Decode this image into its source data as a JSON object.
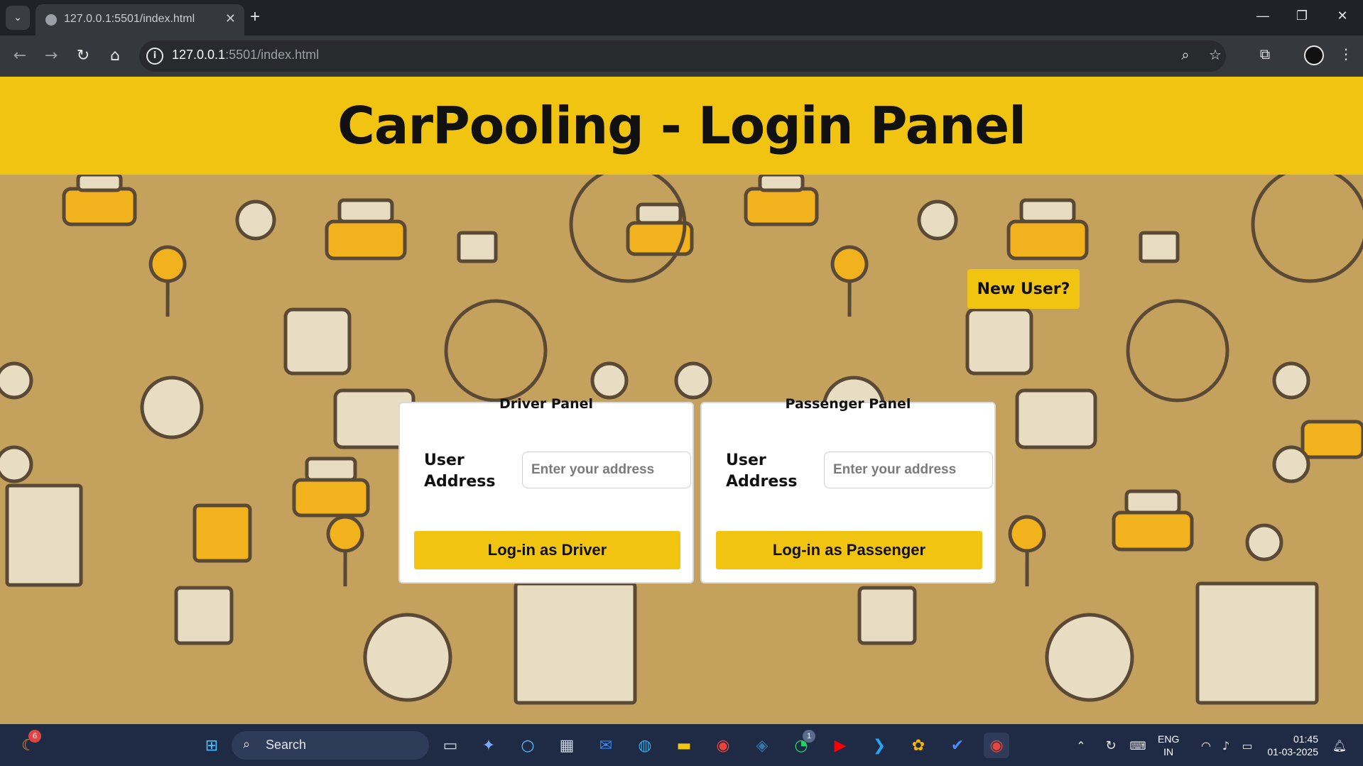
{
  "browser": {
    "tab_title": "127.0.0.1:5501/index.html",
    "url_host": "127.0.0.1",
    "url_rest": ":5501/index.html"
  },
  "page": {
    "heading": "CarPooling - Login Panel",
    "new_user_label": "New User?",
    "panels": [
      {
        "title": "Driver Panel",
        "field_label": "User Address",
        "placeholder": "Enter your address",
        "button": "Log-in as Driver"
      },
      {
        "title": "Passenger Panel",
        "field_label": "User Address",
        "placeholder": "Enter your address",
        "button": "Log-in as Passenger"
      }
    ],
    "colors": {
      "accent": "#f2c412",
      "background": "#c5a15e"
    }
  },
  "taskbar": {
    "search_label": "Search",
    "lang_top": "ENG",
    "lang_bottom": "IN",
    "time": "01:45",
    "date": "01-03-2025",
    "weather_badge": "6",
    "whatsapp_badge": "1"
  }
}
